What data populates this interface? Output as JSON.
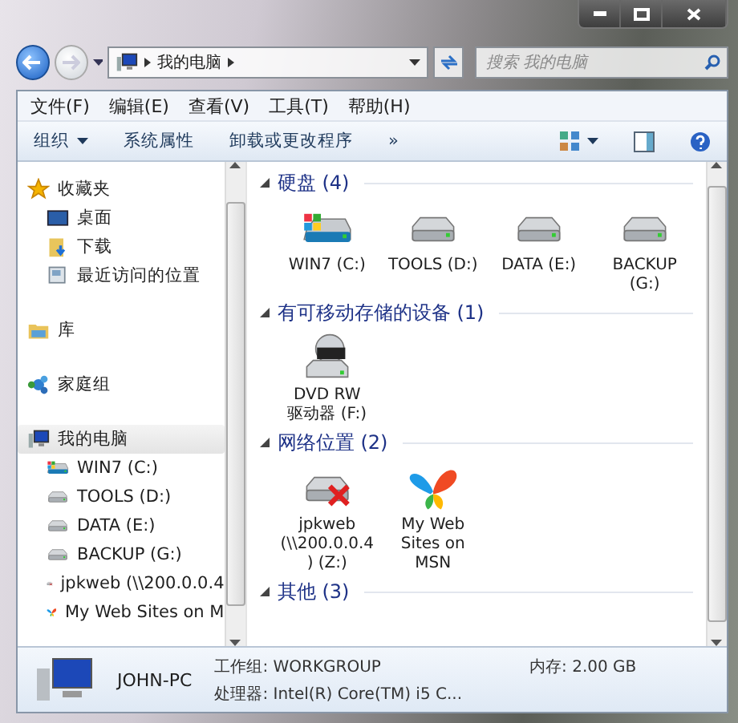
{
  "address": {
    "path": [
      "我的电脑"
    ]
  },
  "search": {
    "placeholder": "搜索 我的电脑"
  },
  "menu": [
    "文件(F)",
    "编辑(E)",
    "查看(V)",
    "工具(T)",
    "帮助(H)"
  ],
  "toolbar": {
    "items": [
      {
        "label": "组织",
        "dropdown": true
      },
      {
        "label": "系统属性",
        "dropdown": false
      },
      {
        "label": "卸载或更改程序",
        "dropdown": false
      }
    ],
    "more": "»"
  },
  "nav": [
    {
      "items": [
        {
          "label": "收藏夹",
          "kind": "star",
          "selected": false,
          "children": [
            {
              "label": "桌面",
              "kind": "desktop",
              "selected": false
            },
            {
              "label": "下载",
              "kind": "download",
              "selected": false
            },
            {
              "label": "最近访问的位置",
              "kind": "recent",
              "selected": false
            }
          ]
        }
      ]
    },
    {
      "items": [
        {
          "label": "库",
          "kind": "library",
          "selected": false
        }
      ]
    },
    {
      "items": [
        {
          "label": "家庭组",
          "kind": "homegroup",
          "selected": false
        }
      ]
    },
    {
      "items": [
        {
          "label": "我的电脑",
          "kind": "computer",
          "selected": true,
          "children": [
            {
              "label": "WIN7 (C:)",
              "kind": "windrive",
              "selected": false
            },
            {
              "label": "TOOLS (D:)",
              "kind": "drive",
              "selected": false
            },
            {
              "label": "DATA (E:)",
              "kind": "drive",
              "selected": false
            },
            {
              "label": "BACKUP (G:)",
              "kind": "drive",
              "selected": false
            },
            {
              "label": "jpkweb (\\\\200.0.0.4",
              "kind": "netdrive",
              "selected": false
            },
            {
              "label": "My Web Sites on M",
              "kind": "msn",
              "selected": false
            }
          ]
        }
      ]
    }
  ],
  "sections": [
    {
      "title": "硬盘",
      "count": "(4)",
      "expanded": true,
      "items": [
        {
          "label": "WIN7 (C:)",
          "kind": "windrive"
        },
        {
          "label": "TOOLS (D:)",
          "kind": "drive"
        },
        {
          "label": "DATA (E:)",
          "kind": "drive"
        },
        {
          "label": "BACKUP (G:)",
          "kind": "drive"
        }
      ]
    },
    {
      "title": "有可移动存储的设备",
      "count": "(1)",
      "expanded": true,
      "items": [
        {
          "label": "DVD RW 驱动器 (F:)",
          "kind": "dvd"
        }
      ]
    },
    {
      "title": "网络位置",
      "count": "(2)",
      "expanded": true,
      "items": [
        {
          "label": "jpkweb (\\\\200.0.0.4) (Z:)",
          "kind": "netdrive"
        },
        {
          "label": "My Web Sites on MSN",
          "kind": "msn"
        }
      ]
    },
    {
      "title": "其他",
      "count": "(3)",
      "expanded": true
    }
  ],
  "status": {
    "name": "JOHN-PC",
    "fields": [
      {
        "label": "工作组:",
        "value": "WORKGROUP"
      },
      {
        "label": "内存:",
        "value": "2.00 GB"
      },
      {
        "label": "处理器:",
        "value": "Intel(R) Core(TM) i5 C..."
      }
    ]
  }
}
